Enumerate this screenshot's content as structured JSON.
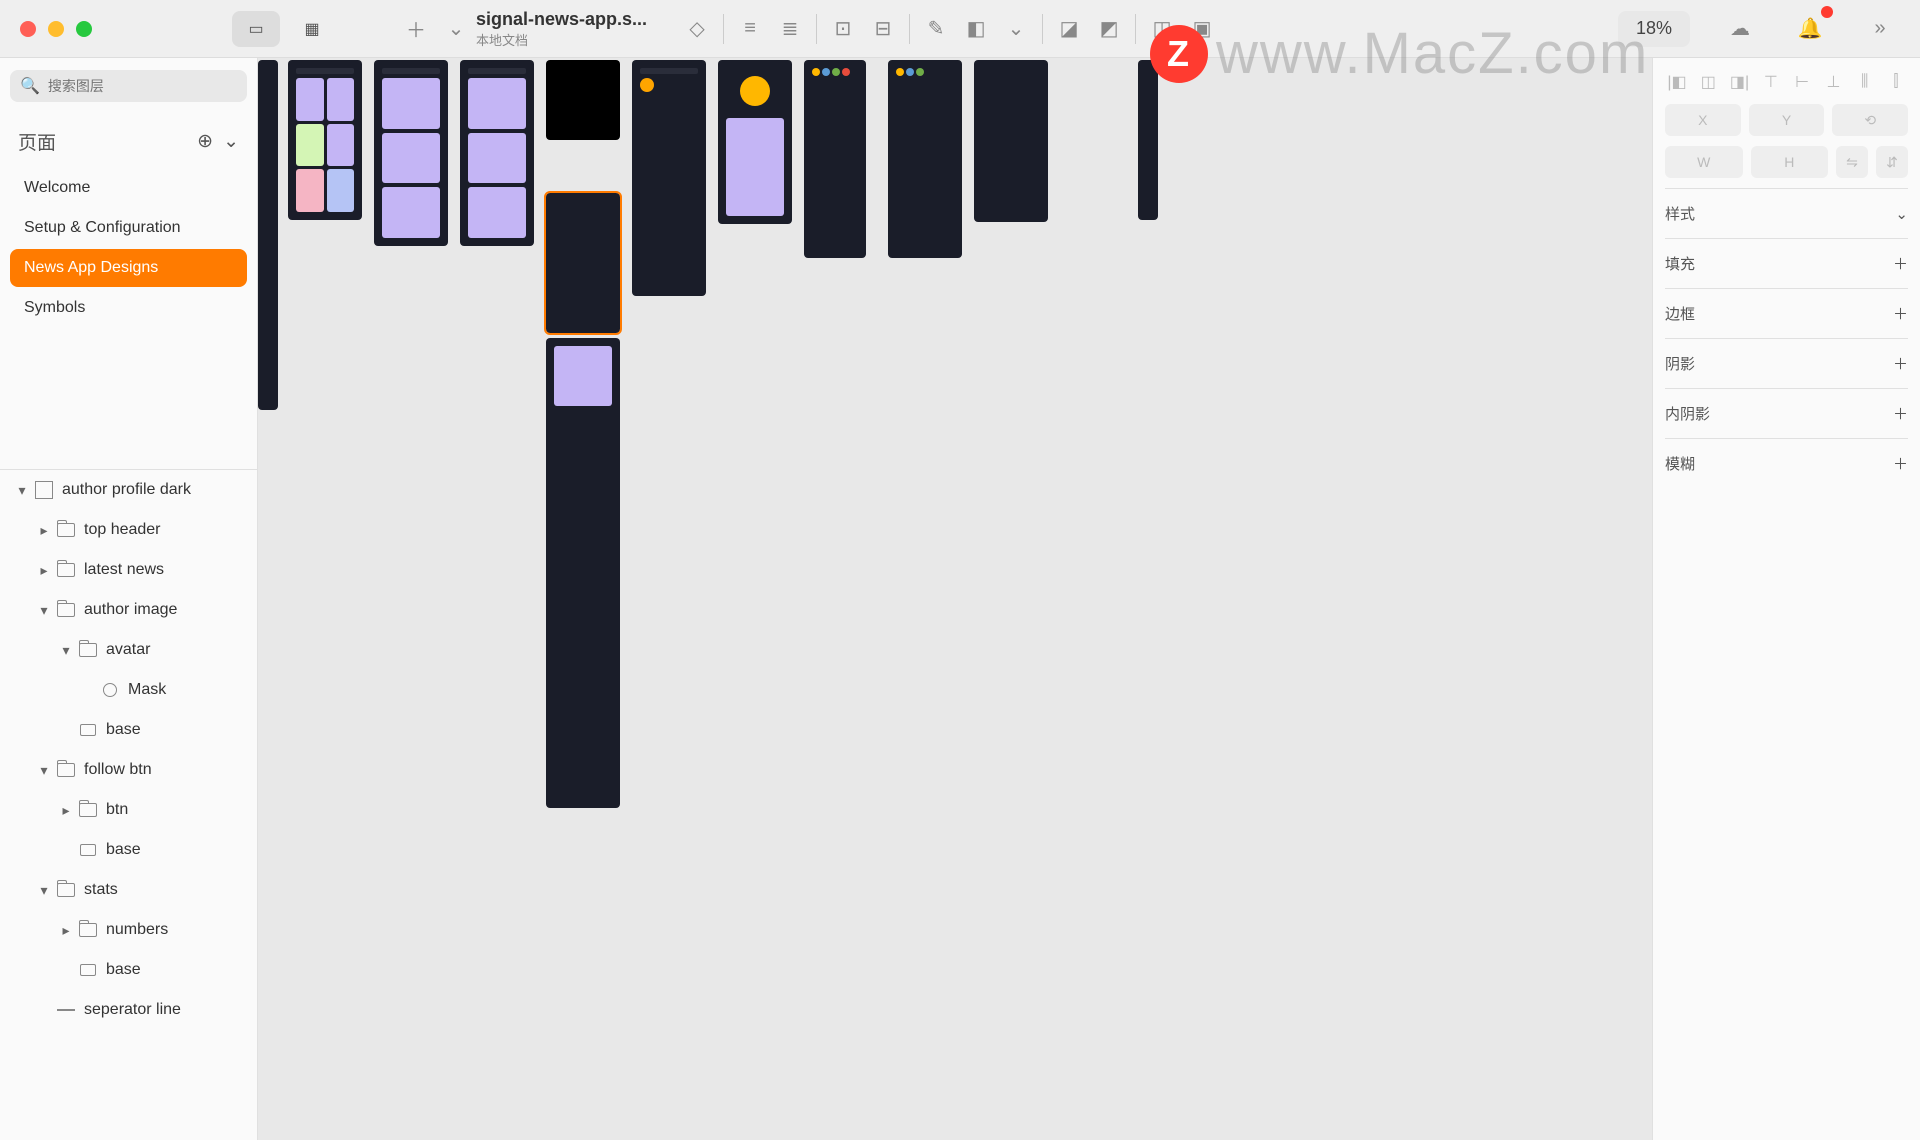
{
  "doc": {
    "name": "signal-news-app.s...",
    "subtitle": "本地文档"
  },
  "zoom": "18%",
  "search_placeholder": "搜索图层",
  "pages_label": "页面",
  "pages": [
    {
      "label": "Welcome"
    },
    {
      "label": "Setup & Configuration"
    },
    {
      "label": "News App Designs"
    },
    {
      "label": "Symbols"
    }
  ],
  "layers": [
    {
      "label": "author profile dark",
      "depth": 0,
      "icon": "artboard",
      "chev": "▾"
    },
    {
      "label": "top header",
      "depth": 1,
      "icon": "folder",
      "chev": "▸"
    },
    {
      "label": "latest news",
      "depth": 1,
      "icon": "folder",
      "chev": "▸"
    },
    {
      "label": "author image",
      "depth": 1,
      "icon": "folder",
      "chev": "▾"
    },
    {
      "label": "avatar",
      "depth": 2,
      "icon": "folder",
      "chev": "▾"
    },
    {
      "label": "Mask",
      "depth": 3,
      "icon": "circle",
      "chev": ""
    },
    {
      "label": "base",
      "depth": 2,
      "icon": "rect",
      "chev": ""
    },
    {
      "label": "follow btn",
      "depth": 1,
      "icon": "folder",
      "chev": "▾"
    },
    {
      "label": "btn",
      "depth": 2,
      "icon": "folder",
      "chev": "▸"
    },
    {
      "label": "base",
      "depth": 2,
      "icon": "rect",
      "chev": ""
    },
    {
      "label": "stats",
      "depth": 1,
      "icon": "folder",
      "chev": "▾"
    },
    {
      "label": "numbers",
      "depth": 2,
      "icon": "folder",
      "chev": "▸"
    },
    {
      "label": "base",
      "depth": 2,
      "icon": "rect",
      "chev": ""
    },
    {
      "label": "seperator line",
      "depth": 1,
      "icon": "line",
      "chev": ""
    }
  ],
  "inspector": {
    "style_label": "样式",
    "fields": {
      "x": "X",
      "y": "Y",
      "w": "W",
      "h": "H"
    },
    "sections": [
      "填充",
      "边框",
      "阴影",
      "内阴影",
      "模糊"
    ]
  },
  "watermark": {
    "badge": "Z",
    "text": "www.MacZ.com"
  }
}
